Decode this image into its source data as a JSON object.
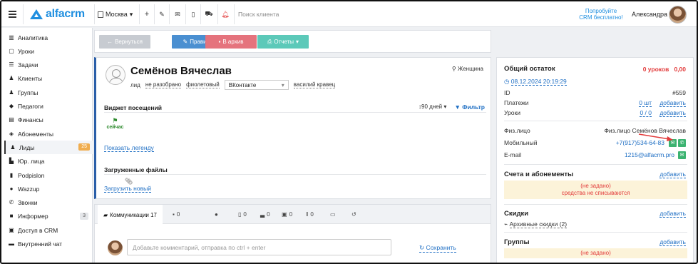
{
  "topbar": {
    "logo": "alfacrm",
    "city": "Москва",
    "search_placeholder": "Поиск клиента",
    "promo_line1": "Попробуйте",
    "promo_line2": "CRM бесплатно!",
    "user_name": "Александра",
    "tools": [
      "plus-icon",
      "wrench-icon",
      "mail-icon",
      "phone-icon",
      "cart-icon",
      "bell-icon"
    ]
  },
  "sidebar": {
    "items": [
      {
        "label": "Аналитика",
        "icon": "analytics-icon"
      },
      {
        "label": "Уроки",
        "icon": "calendar-icon"
      },
      {
        "label": "Задачи",
        "icon": "tasks-icon"
      },
      {
        "label": "Клиенты",
        "icon": "user-icon"
      },
      {
        "label": "Группы",
        "icon": "group-icon"
      },
      {
        "label": "Педагоги",
        "icon": "graduation-icon"
      },
      {
        "label": "Финансы",
        "icon": "money-icon"
      },
      {
        "label": "Абонементы",
        "icon": "tag-icon"
      },
      {
        "label": "Лиды",
        "icon": "lead-icon",
        "badge": "25",
        "active": true
      },
      {
        "label": "Юр. лица",
        "icon": "building-icon"
      },
      {
        "label": "Podpislon",
        "icon": "file-icon"
      },
      {
        "label": "Wazzup",
        "icon": "whatsapp-icon"
      },
      {
        "label": "Звонки",
        "icon": "call-icon"
      },
      {
        "label": "Информер",
        "icon": "informer-icon",
        "badge": "3"
      },
      {
        "label": "Доступ в CRM",
        "icon": "lock-icon"
      },
      {
        "label": "Внутренний чат",
        "icon": "chat-icon"
      }
    ]
  },
  "actions": {
    "back": "Вернуться",
    "edit": "Править",
    "archive": "В архив",
    "reports": "Отчеты"
  },
  "client": {
    "name": "Семёнов Вячеслав",
    "gender": "Женщина",
    "status": "лид",
    "stage": "не разобрано",
    "color": "фиолетовый",
    "source": "ВКонтакте",
    "owner": "василий кравец"
  },
  "visits": {
    "title": "Виджет посещений",
    "period": "90 дней",
    "filter": "Фильтр",
    "now": "сейчас",
    "legend_link": "Показать легенду"
  },
  "files": {
    "title": "Загруженные файлы",
    "upload_link": "Загрузить новый"
  },
  "comms": {
    "tabs": [
      {
        "label": "Коммуникации 17",
        "icon": "comment-icon"
      },
      {
        "label": "0",
        "icon": "message-icon"
      },
      {
        "label": "",
        "icon": "whatsapp-icon"
      },
      {
        "label": "0",
        "icon": "calendar-icon"
      },
      {
        "label": "0",
        "icon": "chart-icon"
      },
      {
        "label": "0",
        "icon": "money-icon"
      },
      {
        "label": "0",
        "icon": "pause-icon"
      },
      {
        "label": "",
        "icon": "photo-icon"
      },
      {
        "label": "",
        "icon": "history-icon"
      }
    ],
    "placeholder": "Добавьте комментарий, отправка по ctrl + enter",
    "save": "Сохранить"
  },
  "balance": {
    "title": "Общий остаток",
    "lessons": "0 уроков",
    "amount": "0,00",
    "date": "08.12.2024 20:19:29",
    "id_label": "ID",
    "id_value": "#559",
    "payments_label": "Платежи",
    "payments_value": "0 шт",
    "lessons_label": "Уроки",
    "lessons_value": "0 / 0",
    "add": "добавить"
  },
  "contact": {
    "person_label": "Физ.лицо",
    "person_value": "Физ.лицо Семёнов Вячеслав",
    "mobile_label": "Мобильный",
    "mobile_value": "+7(917)534-64-83",
    "email_label": "E-mail",
    "email_value": "1215@alfacrm.pro"
  },
  "accounts": {
    "title": "Счета и абонементы",
    "add": "добавить",
    "warn1": "(не задано)",
    "warn2": "средства не списываются"
  },
  "discounts": {
    "title": "Скидки",
    "add": "добавить",
    "archive": "Архивные скидки (2)"
  },
  "groups": {
    "title": "Группы",
    "add": "добавить",
    "warn": "(не задано)"
  },
  "colors": {
    "brand": "#1f8fe0",
    "edit": "#4a8fd1",
    "archive": "#e5737d",
    "reports": "#5cc9b9",
    "red": "#e23b3b",
    "green": "#3cb371"
  }
}
